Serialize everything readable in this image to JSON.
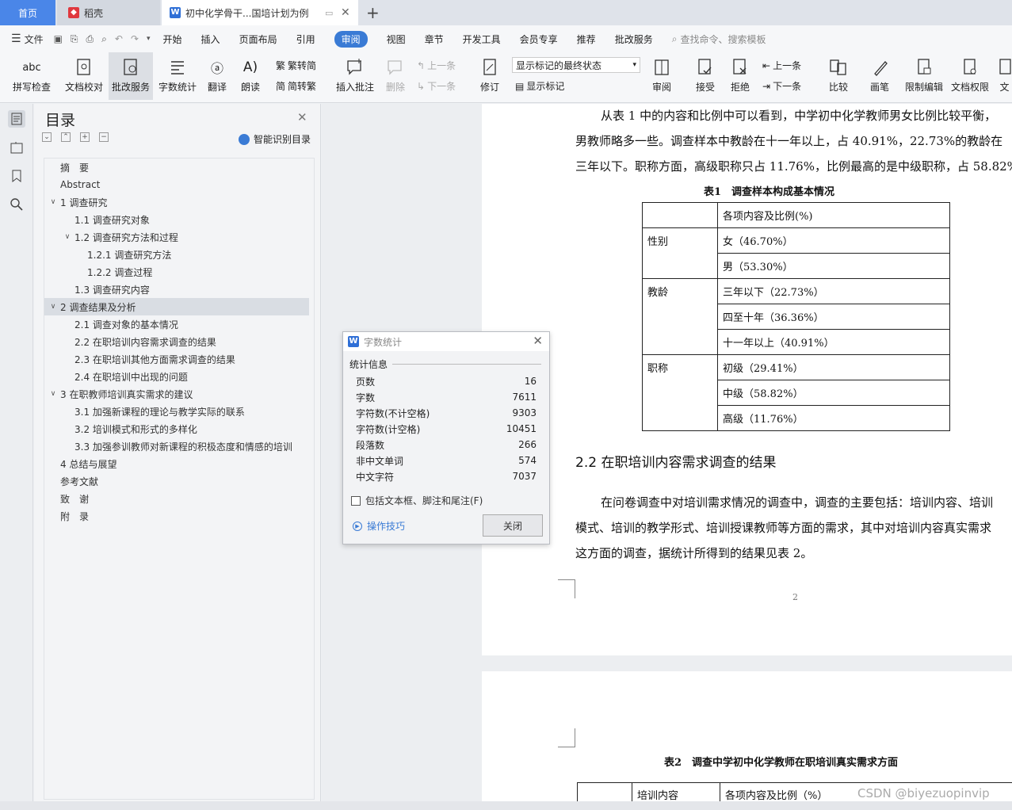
{
  "tabs": {
    "home": "首页",
    "daoke": "稻壳",
    "doc": "初中化学骨干...国培计划为例"
  },
  "menu": [
    "文件",
    "开始",
    "插入",
    "页面布局",
    "引用",
    "审阅",
    "视图",
    "章节",
    "开发工具",
    "会员专享",
    "推荐",
    "批改服务"
  ],
  "menu_active": "审阅",
  "search_placeholder": "查找命令、搜索模板",
  "ribbon": {
    "spell": "拼写检查",
    "doccheck": "文档校对",
    "batch": "批改服务",
    "wordcount": "字数统计",
    "translate": "翻译",
    "read": "朗读",
    "trad2simp": "繁转简",
    "simp2trad": "简转繁",
    "insert_comment": "插入批注",
    "delete": "删除",
    "prev": "上一条",
    "next": "下一条",
    "revise": "修订",
    "display_mode": "显示标记的最终状态",
    "show_marks": "显示标记",
    "review": "审阅",
    "accept": "接受",
    "reject": "拒绝",
    "prev2": "上一条",
    "next2": "下一条",
    "compare": "比较",
    "pen": "画笔",
    "restrict": "限制编辑",
    "permission": "文档权限",
    "more": "文"
  },
  "toc": {
    "title": "目录",
    "smart": "智能识别目录",
    "items": [
      {
        "label": "摘　要",
        "level": 0,
        "arrow": ""
      },
      {
        "label": "Abstract",
        "level": 0,
        "arrow": ""
      },
      {
        "label": "1 调查研究",
        "level": 0,
        "arrow": "v"
      },
      {
        "label": "1.1  调查研究对象",
        "level": 1,
        "arrow": ""
      },
      {
        "label": "1.2  调查研究方法和过程",
        "level": 1,
        "arrow": "v"
      },
      {
        "label": "1.2.1 调查研究方法",
        "level": 2,
        "arrow": ""
      },
      {
        "label": "1.2.2  调查过程",
        "level": 2,
        "arrow": ""
      },
      {
        "label": "1.3  调查研究内容",
        "level": 1,
        "arrow": ""
      },
      {
        "label": "2  调查结果及分析",
        "level": 0,
        "arrow": "v",
        "selected": true
      },
      {
        "label": "2.1  调查对象的基本情况",
        "level": 1,
        "arrow": ""
      },
      {
        "label": "2.2  在职培训内容需求调查的结果",
        "level": 1,
        "arrow": ""
      },
      {
        "label": "2.3  在职培训其他方面需求调查的结果",
        "level": 1,
        "arrow": ""
      },
      {
        "label": "2.4  在职培训中出现的问题",
        "level": 1,
        "arrow": ""
      },
      {
        "label": "3  在职教师培训真实需求的建议",
        "level": 0,
        "arrow": "v"
      },
      {
        "label": "3.1  加强新课程的理论与教学实际的联系",
        "level": 1,
        "arrow": ""
      },
      {
        "label": "3.2  培训模式和形式的多样化",
        "level": 1,
        "arrow": ""
      },
      {
        "label": "3.3  加强参训教师对新课程的积极态度和情感的培训",
        "level": 1,
        "arrow": ""
      },
      {
        "label": "4  总结与展望",
        "level": 0,
        "arrow": ""
      },
      {
        "label": "参考文献",
        "level": 0,
        "arrow": ""
      },
      {
        "label": "致　谢",
        "level": 0,
        "arrow": ""
      },
      {
        "label": "附　录",
        "level": 0,
        "arrow": ""
      }
    ]
  },
  "doc": {
    "p1_l1": "从表 1 中的内容和比例中可以看到，中学初中化学教师男女比例比较平衡，",
    "p1_l2": "男教师略多一些。调查样本中教龄在十一年以上，占 40.91%，22.73%的教龄在",
    "p1_l3": "三年以下。职称方面，高级职称只占 11.76%，比例最高的是中级职称，占 58.82%。",
    "table1_caption": "表1　调查样本构成基本情况",
    "table1": {
      "header": "各项内容及比例(%)",
      "groups": [
        {
          "name": "性别",
          "rows": [
            "女（46.70%）",
            "男（53.30%）"
          ]
        },
        {
          "name": "教龄",
          "rows": [
            "三年以下（22.73%）",
            "四至十年（36.36%）",
            "十一年以上（40.91%）"
          ]
        },
        {
          "name": "职称",
          "rows": [
            "初级（29.41%）",
            "中级（58.82%）",
            "高级（11.76%）"
          ]
        }
      ]
    },
    "heading22": "2.2  在职培训内容需求调查的结果",
    "p2_l1": "在问卷调查中对培训需求情况的调查中，调查的主要包括：培训内容、培训",
    "p2_l2": "模式、培训的教学形式、培训授课教师等方面的需求，其中对培训内容真实需求",
    "p2_l3": "这方面的调查，据统计所得到的结果见表 2。",
    "page_num": "2",
    "table2_caption": "表2　调查中学初中化学教师在职培训真实需求方面",
    "table2_h1": "培训内容",
    "table2_h2": "各项内容及比例（%）"
  },
  "dialog": {
    "title": "字数统计",
    "section": "统计信息",
    "stats": [
      {
        "label": "页数",
        "value": "16"
      },
      {
        "label": "字数",
        "value": "7611"
      },
      {
        "label": "字符数(不计空格)",
        "value": "9303"
      },
      {
        "label": "字符数(计空格)",
        "value": "10451"
      },
      {
        "label": "段落数",
        "value": "266"
      },
      {
        "label": "非中文单词",
        "value": "574"
      },
      {
        "label": "中文字符",
        "value": "7037"
      }
    ],
    "checkbox": "包括文本框、脚注和尾注(F)",
    "tips": "操作技巧",
    "close": "关闭"
  },
  "watermark": "CSDN @biyezuopinvip",
  "colors": {
    "accent": "#3a7bd5",
    "tab_active": "#4a86e8"
  }
}
